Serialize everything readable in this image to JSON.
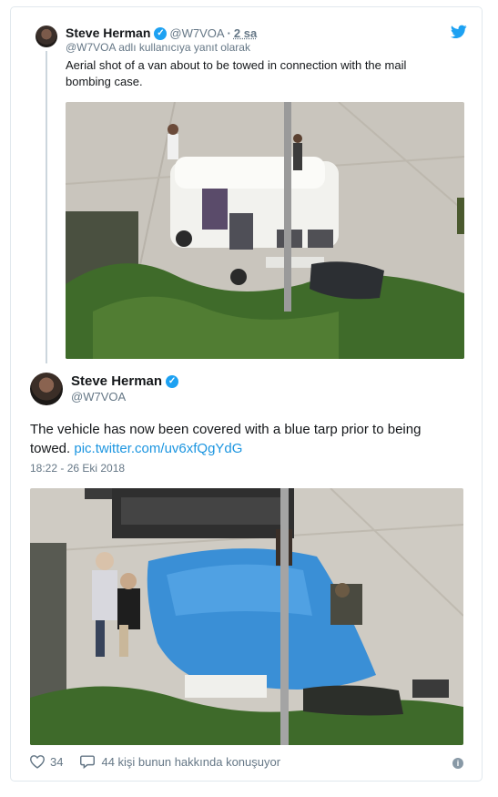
{
  "tweet_parent": {
    "name": "Steve Herman",
    "handle": "@W7VOA",
    "separator": "·",
    "time": "2 sa",
    "reply_note": "@W7VOA adlı kullanıcıya yanıt olarak",
    "text": "Aerial shot of a van about to be towed in connection with the mail bombing case."
  },
  "tweet_main": {
    "name": "Steve Herman",
    "handle": "@W7VOA",
    "text": "The vehicle has now been covered with a blue tarp prior to being towed. ",
    "link": "pic.twitter.com/uv6xfQgYdG",
    "timestamp": "18:22 - 26 Eki 2018"
  },
  "footer": {
    "likes": "34",
    "replies_text": "44 kişi bunun hakkında konuşuyor"
  },
  "icons": {
    "verified": "verified-badge-icon",
    "twitter": "twitter-bird-icon",
    "heart": "heart-icon",
    "comment": "comment-bubble-icon",
    "info": "info-icon"
  },
  "colors": {
    "brand_blue": "#1da1f2",
    "link": "#1b95e0",
    "muted": "#657786",
    "tarp_blue": "#3a8fd6"
  }
}
